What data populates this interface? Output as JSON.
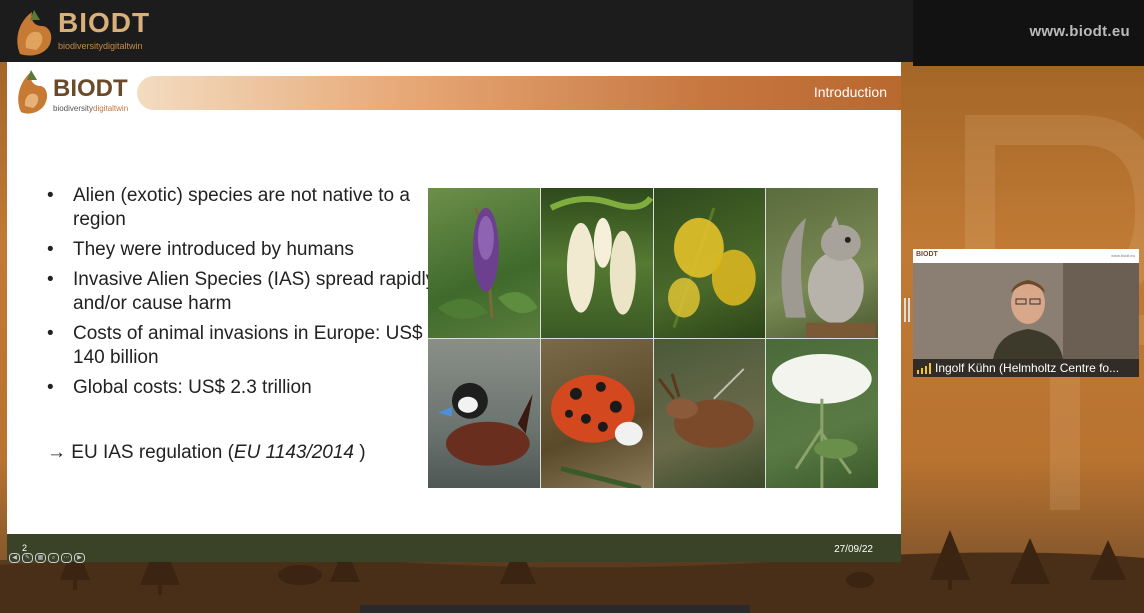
{
  "window": {
    "site_url": "www.biodt.eu",
    "brand_name": "BIODT",
    "brand_tagline": "biodiversitydigitaltwin"
  },
  "slide": {
    "logo_word": "BIODT",
    "logo_tagline_a": "biodiversity",
    "logo_tagline_b": "digitaltwin",
    "section_title": "Introduction",
    "bullets": [
      "Alien (exotic) species are not native to a region",
      "They were introduced by humans",
      "Invasive Alien Species (IAS) spread rapidly and/or cause harm",
      "Costs of animal invasions in Europe: US$ 140 billion",
      "Global costs: US$ 2.3 trillion"
    ],
    "regulation_prefix": "→ EU IAS regulation (",
    "regulation_ref": "EU 1143/2014",
    "regulation_suffix": " )",
    "number": "2",
    "date": "27/09/22"
  },
  "participant": {
    "name": "Ingolf Kühn (Helmholtz Centre fo...",
    "mini_logo": "BIODT",
    "mini_url": "www.biodt.eu"
  },
  "colors": {
    "accent": "#c6763f",
    "footer": "#3a4327",
    "brand_text": "#6b4a2a"
  }
}
